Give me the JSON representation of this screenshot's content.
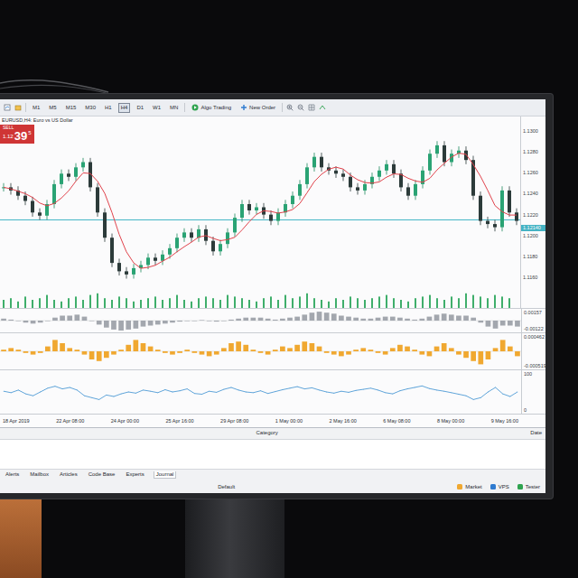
{
  "toolbar": {
    "timeframes": [
      {
        "label": "M1",
        "selected": false
      },
      {
        "label": "M5",
        "selected": false
      },
      {
        "label": "M15",
        "selected": false
      },
      {
        "label": "M30",
        "selected": false
      },
      {
        "label": "H1",
        "selected": false
      },
      {
        "label": "H4",
        "selected": true
      },
      {
        "label": "D1",
        "selected": false
      },
      {
        "label": "W1",
        "selected": false
      },
      {
        "label": "MN",
        "selected": false
      }
    ],
    "buttons": [
      "Algo Trading",
      "New Order"
    ]
  },
  "trade_panel": {
    "side": "SELL",
    "price_prefix": "1.12",
    "price_big": "39",
    "price_sup": "5"
  },
  "chart": {
    "symbol": "EURUSD,H4: Euro vs US Dollar",
    "price_axis": [
      "1.1300",
      "1.1280",
      "1.1260",
      "1.1240",
      "1.1220",
      "1.1200",
      "1.1180",
      "1.1160"
    ],
    "current_price": "1.12140",
    "hline": 1.1215,
    "axis_min": 1.115,
    "axis_max": 1.131,
    "closes": [
      1.1246,
      1.1243,
      1.1238,
      1.1233,
      1.1222,
      1.1219,
      1.123,
      1.1249,
      1.1259,
      1.1256,
      1.1265,
      1.127,
      1.1246,
      1.1222,
      1.1198,
      1.1174,
      1.1166,
      1.1163,
      1.1169,
      1.1172,
      1.1179,
      1.1176,
      1.1182,
      1.1188,
      1.1198,
      1.1203,
      1.1198,
      1.1206,
      1.1195,
      1.1185,
      1.1192,
      1.1203,
      1.1217,
      1.123,
      1.1224,
      1.1227,
      1.122,
      1.1214,
      1.1222,
      1.123,
      1.1238,
      1.1249,
      1.1265,
      1.1275,
      1.1265,
      1.1262,
      1.1259,
      1.1256,
      1.1246,
      1.1243,
      1.1249,
      1.1256,
      1.1262,
      1.1268,
      1.1259,
      1.1246,
      1.1238,
      1.1249,
      1.1262,
      1.1278,
      1.1286,
      1.127,
      1.1278,
      1.1281,
      1.1272,
      1.1238,
      1.1214,
      1.1211,
      1.1208,
      1.1243,
      1.1222,
      1.1214
    ],
    "volume": [
      5,
      6,
      4,
      7,
      5,
      6,
      8,
      5,
      4,
      6,
      7,
      5,
      8,
      9,
      6,
      5,
      7,
      6,
      4,
      5,
      6,
      7,
      5,
      6,
      8,
      5,
      4,
      6,
      7,
      6,
      5,
      8,
      7,
      6,
      5,
      4,
      6,
      7,
      5,
      8,
      6,
      7,
      9,
      6,
      5,
      4,
      6,
      5,
      7,
      6,
      5,
      6,
      7,
      8,
      6,
      5,
      4,
      6,
      7,
      8,
      6,
      5,
      7,
      6,
      9,
      8,
      7,
      6,
      8,
      7,
      6
    ]
  },
  "macd": {
    "axis": [
      "0.00157",
      "-0.00122"
    ],
    "values": [
      0.2,
      0.1,
      0,
      -0.2,
      -0.3,
      -0.2,
      0,
      0.3,
      0.5,
      0.5,
      0.6,
      0.4,
      0,
      -0.4,
      -0.7,
      -0.9,
      -1,
      -0.9,
      -0.8,
      -0.6,
      -0.5,
      -0.4,
      -0.3,
      -0.2,
      -0.1,
      0,
      0,
      0.05,
      -0.05,
      -0.1,
      0,
      0.1,
      0.2,
      0.3,
      0.3,
      0.3,
      0.2,
      0.1,
      0.2,
      0.3,
      0.4,
      0.6,
      0.8,
      0.9,
      0.8,
      0.7,
      0.5,
      0.4,
      0.3,
      0.2,
      0.2,
      0.3,
      0.4,
      0.4,
      0.3,
      0.2,
      0.1,
      0.2,
      0.4,
      0.6,
      0.7,
      0.6,
      0.5,
      0.5,
      0.3,
      -0.2,
      -0.6,
      -0.8,
      -0.5,
      -0.5,
      -0.6
    ]
  },
  "oscillator": {
    "axis": [
      "0.000462",
      "-0.000519"
    ],
    "values": [
      0.1,
      0.2,
      0.1,
      -0.1,
      -0.2,
      -0.1,
      0.3,
      0.7,
      0.5,
      0.2,
      0.1,
      -0.2,
      -0.5,
      -0.6,
      -0.4,
      -0.2,
      0.1,
      0.4,
      0.7,
      0.5,
      0.3,
      0.1,
      -0.1,
      -0.2,
      -0.1,
      0.1,
      -0.1,
      -0.2,
      -0.3,
      -0.2,
      0.2,
      0.5,
      0.6,
      0.4,
      0.1,
      -0.1,
      -0.2,
      0.1,
      0.3,
      0.2,
      0.4,
      0.6,
      0.5,
      0.3,
      -0.1,
      -0.2,
      -0.3,
      -0.2,
      0.1,
      0.2,
      0.1,
      -0.1,
      -0.2,
      0.2,
      0.4,
      0.3,
      0.1,
      -0.2,
      -0.3,
      0.3,
      0.5,
      0.2,
      -0.2,
      -0.4,
      -0.6,
      -0.8,
      -0.5,
      0.2,
      0.7,
      0.3,
      -0.3
    ]
  },
  "line_indicator": {
    "axis": [
      "100",
      "0"
    ],
    "values": [
      52,
      48,
      55,
      45,
      40,
      50,
      60,
      65,
      58,
      62,
      55,
      40,
      35,
      30,
      42,
      38,
      45,
      50,
      47,
      55,
      52,
      48,
      56,
      50,
      53,
      58,
      46,
      44,
      52,
      49,
      57,
      62,
      55,
      50,
      48,
      53,
      46,
      51,
      56,
      60,
      64,
      58,
      61,
      55,
      50,
      47,
      52,
      49,
      54,
      57,
      60,
      55,
      48,
      45,
      53,
      58,
      62,
      66,
      59,
      55,
      52,
      48,
      44,
      40,
      30,
      35,
      50,
      62,
      45,
      38,
      50
    ]
  },
  "time_axis": [
    "18 Apr 2019",
    "22 Apr 08:00",
    "24 Apr 00:00",
    "25 Apr 16:00",
    "29 Apr 08:00",
    "1 May 00:00",
    "2 May 16:00",
    "6 May 08:00",
    "8 May 00:00",
    "9 May 16:00"
  ],
  "toolbox": {
    "columns": [
      "Category",
      "Date"
    ],
    "tabs": [
      {
        "label": "Alerts",
        "selected": false
      },
      {
        "label": "Mailbox",
        "selected": false
      },
      {
        "label": "Articles",
        "selected": false
      },
      {
        "label": "Code Base",
        "selected": false
      },
      {
        "label": "Experts",
        "selected": false
      },
      {
        "label": "Journal",
        "selected": true
      }
    ],
    "status": "Default",
    "status_items": [
      "Market",
      "VPS",
      "Tester"
    ]
  }
}
